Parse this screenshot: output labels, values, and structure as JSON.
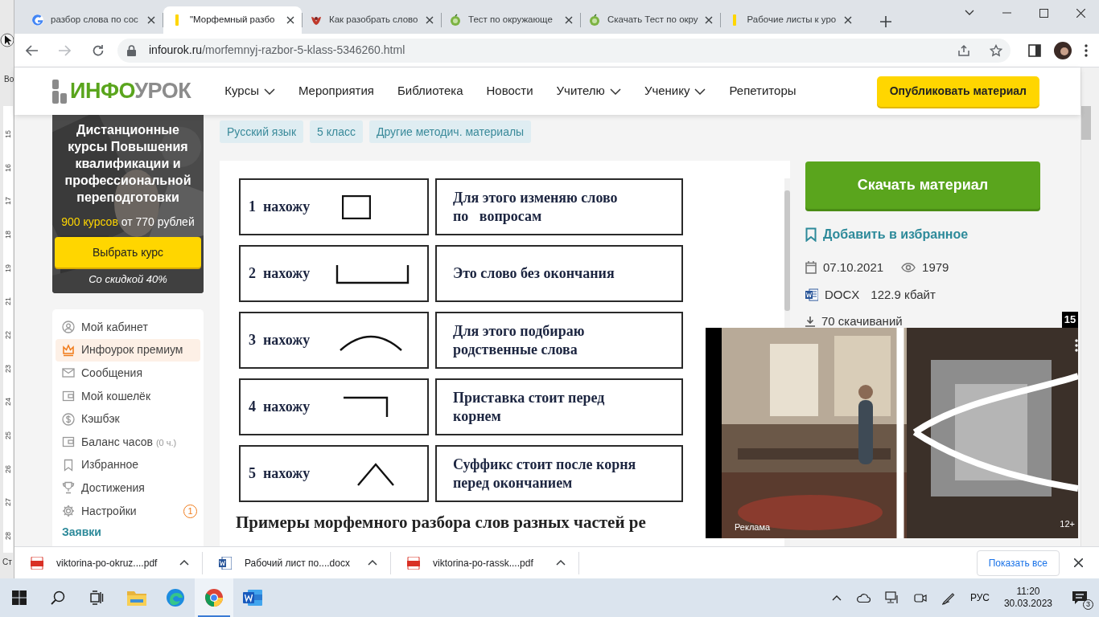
{
  "background_window": {
    "edge_texts": [
      "Во",
      "Ст"
    ],
    "ruler_numbers": [
      "15",
      "16",
      "17",
      "18",
      "19",
      "21",
      "22",
      "23",
      "24",
      "25",
      "26",
      "27",
      "28"
    ]
  },
  "browser": {
    "tabs": [
      {
        "title": "разбор слова по сос",
        "selected": false
      },
      {
        "title": "\"Морфемный разбо",
        "selected": true
      },
      {
        "title": "Как разобрать слово",
        "selected": false
      },
      {
        "title": "Тест по окружающе",
        "selected": false
      },
      {
        "title": "Скачать Тест по окру",
        "selected": false
      },
      {
        "title": "Рабочие листы к уро",
        "selected": false
      }
    ],
    "address": {
      "host": "infourok.ru",
      "path": "/morfemnyj-razbor-5-klass-5346260.html"
    }
  },
  "site_header": {
    "logo": {
      "first_part": "ИНФО",
      "second_part": "УРОК"
    },
    "nav": [
      {
        "label": "Курсы",
        "has_dropdown": true
      },
      {
        "label": "Мероприятия",
        "has_dropdown": false
      },
      {
        "label": "Библиотека",
        "has_dropdown": false
      },
      {
        "label": "Новости",
        "has_dropdown": false
      },
      {
        "label": "Учителю",
        "has_dropdown": true
      },
      {
        "label": "Ученику",
        "has_dropdown": true
      },
      {
        "label": "Репетиторы",
        "has_dropdown": false
      }
    ],
    "publish_button": "Опубликовать материал"
  },
  "promo": {
    "title": "Дистанционные курсы Повышения квалификации и профессиональной переподготовки",
    "offer_count": "900 курсов",
    "offer_price": "от 770 рублей",
    "button": "Выбрать курс",
    "discount": "Со скидкой 40%"
  },
  "sidebar_menu": {
    "items": [
      {
        "label": "Мой кабинет",
        "selected": false
      },
      {
        "label": "Инфоурок премиум",
        "selected": true
      },
      {
        "label": "Сообщения",
        "selected": false
      },
      {
        "label": "Мой кошелёк",
        "selected": false
      },
      {
        "label": "Кэшбэк",
        "selected": false
      },
      {
        "label": "Баланс часов",
        "note": "(0 ч.)",
        "selected": false
      },
      {
        "label": "Избранное",
        "selected": false
      },
      {
        "label": "Достижения",
        "selected": false
      },
      {
        "label": "Настройки",
        "badge": "1",
        "selected": false
      }
    ],
    "section_link": "Заявки"
  },
  "tags": [
    "Русский язык",
    "5 класс",
    "Другие методич. материалы"
  ],
  "morpheme_table": [
    {
      "step": "1",
      "verb": "нахожу",
      "explanation_lines": [
        "Для этого изменяю слово",
        "по   вопросам"
      ]
    },
    {
      "step": "2",
      "verb": "нахожу",
      "explanation_lines": [
        "Это слово без окончания"
      ]
    },
    {
      "step": "3",
      "verb": "нахожу",
      "explanation_lines": [
        "Для этого подбираю",
        "родственные слова"
      ]
    },
    {
      "step": "4",
      "verb": "нахожу",
      "explanation_lines": [
        "Приставка стоит перед",
        "корнем"
      ]
    },
    {
      "step": "5",
      "verb": "нахожу",
      "explanation_lines": [
        "Суффикс стоит после корня",
        "перед окончанием"
      ]
    }
  ],
  "section_heading": "Примеры морфемного разбора слов разных частей ре",
  "material": {
    "download_button": "Скачать материал",
    "favorite_link": "Добавить в избранное",
    "date": "07.10.2021",
    "views": "1979",
    "format": "DOCX",
    "size": "122.9 кбайт",
    "downloads": "70 скачиваний"
  },
  "ad": {
    "countdown": "15",
    "label": "Реклама",
    "age_rating": "12+"
  },
  "downloads_bar": {
    "items": [
      {
        "file": "viktorina-po-okruz....pdf"
      },
      {
        "file": "Рабочий лист по....docx"
      },
      {
        "file": "viktorina-po-rassk....pdf"
      }
    ],
    "show_all": "Показать все"
  },
  "taskbar": {
    "buttons": [
      {
        "active": false
      },
      {
        "active": false
      },
      {
        "active": false
      },
      {
        "active": false
      },
      {
        "active": false
      },
      {
        "active": true
      },
      {
        "active": false
      }
    ],
    "language": "РУС",
    "time": "11:20",
    "date": "30.03.2023",
    "notifications": "3"
  }
}
